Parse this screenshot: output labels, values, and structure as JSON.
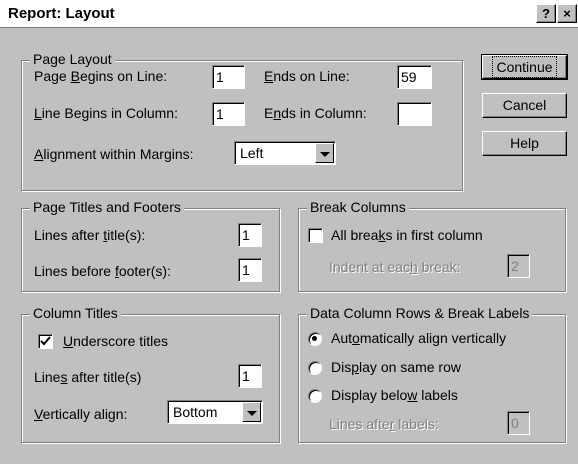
{
  "window": {
    "title": "Report: Layout",
    "help_btn": "?",
    "close_btn": "×"
  },
  "page_layout": {
    "legend": "Page Layout",
    "page_begins": {
      "pre": "Page ",
      "u": "B",
      "post": "egins on Line:",
      "value": "1"
    },
    "ends_on": {
      "pre": "",
      "u": "E",
      "post": "nds on Line:",
      "value": "59"
    },
    "line_begins": {
      "pre": "",
      "u": "L",
      "post": "ine Begins in Column:",
      "value": "1"
    },
    "ends_in": {
      "pre": "E",
      "u": "n",
      "post": "ds in Column:",
      "value": ""
    },
    "alignment": {
      "pre": "",
      "u": "A",
      "post": "lignment within Margins:",
      "value": "Left"
    }
  },
  "buttons": {
    "continue": "Continue",
    "cancel": "Cancel",
    "help": "Help"
  },
  "titles_footers": {
    "legend": "Page Titles and Footers",
    "after": {
      "pre": "Lines after ",
      "u": "t",
      "post": "itle(s):",
      "value": "1"
    },
    "before": {
      "pre": "Lines before ",
      "u": "f",
      "post": "ooter(s):",
      "value": "1"
    }
  },
  "break_columns": {
    "legend": "Break Columns",
    "all_breaks": {
      "pre": "All brea",
      "u": "k",
      "post": "s in first column",
      "checked": false
    },
    "indent": {
      "pre": "Indent at eac",
      "u": "h",
      "post": " break:",
      "value": "2"
    }
  },
  "column_titles": {
    "legend": "Column Titles",
    "underscore": {
      "pre": "",
      "u": "U",
      "post": "nderscore titles",
      "checked": true
    },
    "lines_after": {
      "pre": "Line",
      "u": "s",
      "post": " after title(s)",
      "value": "1"
    },
    "valign": {
      "pre": "",
      "u": "V",
      "post": "ertically align:",
      "value": "Bottom"
    }
  },
  "data_rows": {
    "legend": "Data Column Rows & Break Labels",
    "auto": {
      "pre": "Aut",
      "u": "o",
      "post": "matically align vertically",
      "selected": true
    },
    "same_row": {
      "pre": "Dis",
      "u": "p",
      "post": "lay on same row",
      "selected": false
    },
    "below": {
      "pre": "Display belo",
      "u": "w",
      "post": " labels",
      "selected": false
    },
    "lines_after_labels": {
      "pre": "Lines afte",
      "u": "r",
      "post": " labels:",
      "value": "0"
    }
  }
}
